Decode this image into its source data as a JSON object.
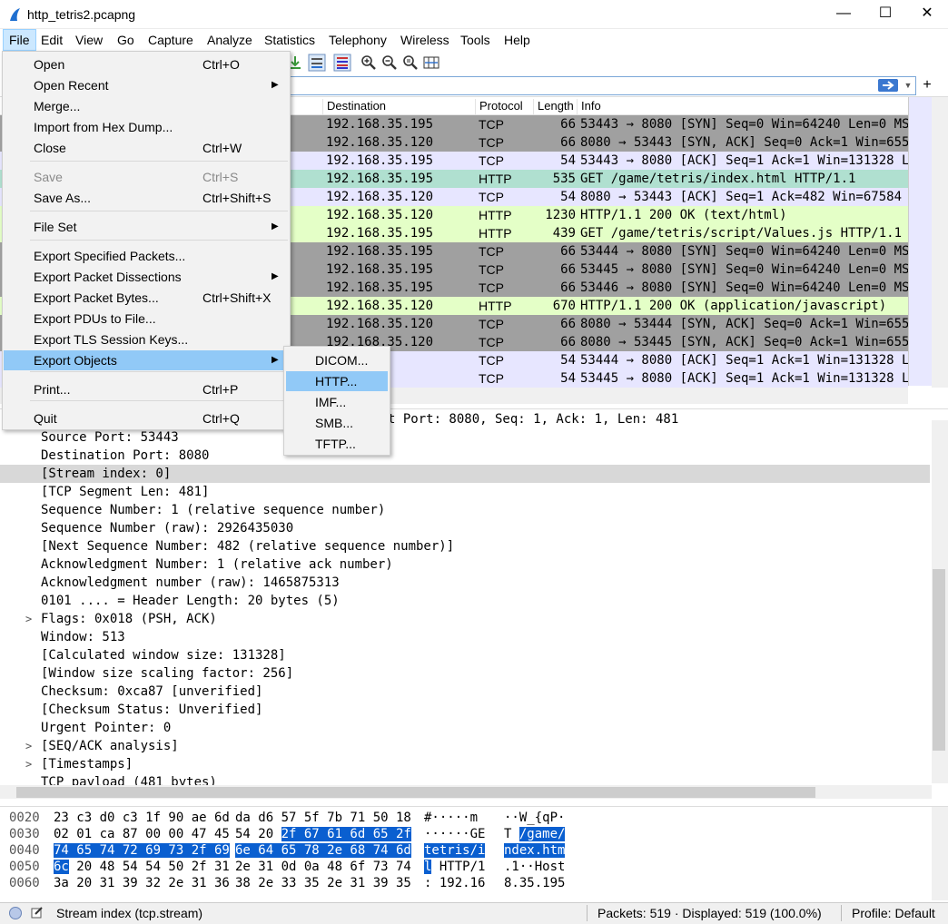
{
  "window": {
    "title": "http_tetris2.pcapng",
    "minimize": "—",
    "maximize": "☐",
    "close": "✕"
  },
  "menubar": [
    "File",
    "Edit",
    "View",
    "Go",
    "Capture",
    "Analyze",
    "Statistics",
    "Telephony",
    "Wireless",
    "Tools",
    "Help"
  ],
  "columns": {
    "destination": "Destination",
    "protocol": "Protocol",
    "length": "Length",
    "info": "Info"
  },
  "packets": [
    {
      "dst": "192.168.35.195",
      "proto": "TCP",
      "len": "66",
      "info": "53443 → 8080 [SYN] Seq=0 Win=64240 Len=0 MSS=",
      "style": "gray"
    },
    {
      "dst": "192.168.35.120",
      "proto": "TCP",
      "len": "66",
      "info": "8080 → 53443 [SYN, ACK] Seq=0 Ack=1 Win=65535",
      "style": "gray"
    },
    {
      "dst": "192.168.35.195",
      "proto": "TCP",
      "len": "54",
      "info": "53443 → 8080 [ACK] Seq=1 Ack=1 Win=131328 Len",
      "style": "lav"
    },
    {
      "dst": "192.168.35.195",
      "proto": "HTTP",
      "len": "535",
      "info": "GET /game/tetris/index.html HTTP/1.1",
      "style": "sel"
    },
    {
      "dst": "192.168.35.120",
      "proto": "TCP",
      "len": "54",
      "info": "8080 → 53443 [ACK] Seq=1 Ack=482 Win=67584 Le",
      "style": "lav"
    },
    {
      "dst": "192.168.35.120",
      "proto": "HTTP",
      "len": "1230",
      "info": "HTTP/1.1 200 OK  (text/html)",
      "style": "green"
    },
    {
      "dst": "192.168.35.195",
      "proto": "HTTP",
      "len": "439",
      "info": "GET /game/tetris/script/Values.js HTTP/1.1",
      "style": "green"
    },
    {
      "dst": "192.168.35.195",
      "proto": "TCP",
      "len": "66",
      "info": "53444 → 8080 [SYN] Seq=0 Win=64240 Len=0 MSS=",
      "style": "gray"
    },
    {
      "dst": "192.168.35.195",
      "proto": "TCP",
      "len": "66",
      "info": "53445 → 8080 [SYN] Seq=0 Win=64240 Len=0 MSS=",
      "style": "gray"
    },
    {
      "dst": "192.168.35.195",
      "proto": "TCP",
      "len": "66",
      "info": "53446 → 8080 [SYN] Seq=0 Win=64240 Len=0 MSS=",
      "style": "gray"
    },
    {
      "dst": "192.168.35.120",
      "proto": "HTTP",
      "len": "670",
      "info": "HTTP/1.1 200 OK  (application/javascript)",
      "style": "green"
    },
    {
      "dst": "192.168.35.120",
      "proto": "TCP",
      "len": "66",
      "info": "8080 → 53444 [SYN, ACK] Seq=0 Ack=1 Win=65535",
      "style": "gray"
    },
    {
      "dst": "192.168.35.120",
      "proto": "TCP",
      "len": "66",
      "info": "8080 → 53445 [SYN, ACK] Seq=0 Ack=1 Win=65535",
      "style": "gray"
    },
    {
      "dst": ".35.195",
      "proto": "TCP",
      "len": "54",
      "info": "53444 → 8080 [ACK] Seq=1 Ack=1 Win=131328 Len",
      "style": "lav"
    },
    {
      "dst": ".35.195",
      "proto": "TCP",
      "len": "54",
      "info": "53445 → 8080 [ACK] Seq=1 Ack=1 Win=131328 Len",
      "style": "lav"
    }
  ],
  "detail": [
    {
      "text": "t Port: 8080, Seq: 1, Ack: 1, Len: 481",
      "exp": ""
    },
    {
      "text": "Source Port: 53443",
      "exp": ""
    },
    {
      "text": "Destination Port: 8080",
      "exp": ""
    },
    {
      "text": "[Stream index: 0]",
      "exp": "",
      "hl": true
    },
    {
      "text": "[TCP Segment Len: 481]",
      "exp": ""
    },
    {
      "text": "Sequence Number: 1    (relative sequence number)",
      "exp": ""
    },
    {
      "text": "Sequence Number (raw): 2926435030",
      "exp": ""
    },
    {
      "text": "[Next Sequence Number: 482    (relative sequence number)]",
      "exp": ""
    },
    {
      "text": "Acknowledgment Number: 1    (relative ack number)",
      "exp": ""
    },
    {
      "text": "Acknowledgment number (raw): 1465875313",
      "exp": ""
    },
    {
      "text": "0101 .... = Header Length: 20 bytes (5)",
      "exp": ""
    },
    {
      "text": "Flags: 0x018 (PSH, ACK)",
      "exp": ">"
    },
    {
      "text": "Window: 513",
      "exp": ""
    },
    {
      "text": "[Calculated window size: 131328]",
      "exp": ""
    },
    {
      "text": "[Window size scaling factor: 256]",
      "exp": ""
    },
    {
      "text": "Checksum: 0xca87 [unverified]",
      "exp": ""
    },
    {
      "text": "[Checksum Status: Unverified]",
      "exp": ""
    },
    {
      "text": "Urgent Pointer: 0",
      "exp": ""
    },
    {
      "text": "[SEQ/ACK analysis]",
      "exp": ">"
    },
    {
      "text": "[Timestamps]",
      "exp": ">"
    },
    {
      "text": "TCP payload (481 bytes)",
      "exp": ""
    }
  ],
  "hex": [
    {
      "off": "0020",
      "b1": "23 c3 d0 c3 1f 90 ae 6d",
      "b2": "da d6 57 5f 7b 71 50 18",
      "a1": "#·····m ",
      "a2": "··W_{qP·",
      "sel1": "",
      "sel2": "",
      "asel1": "",
      "asel2": ""
    },
    {
      "off": "0030",
      "b1": "02 01 ca 87 00 00 47 45",
      "b2": "54 20 ",
      "b2sel": "2f 67 61 6d 65 2f",
      "a1": "······GE",
      "a2": "T ",
      "a2sel": "/game/"
    },
    {
      "off": "0040",
      "b1sel": "74 65 74 72 69 73 2f 69",
      "b2sel": "6e 64 65 78 2e 68 74 6d",
      "a1sel": "tetris/i",
      "a2sel": "ndex.htm"
    },
    {
      "off": "0050",
      "b1selpre": "6c",
      "b1": " 20 48 54 54 50 2f 31",
      "b2": "2e 31 0d 0a 48 6f 73 74",
      "a1selpre": "l",
      "a1": " HTTP/1",
      "a2": ".1··Host"
    },
    {
      "off": "0060",
      "b1": "3a 20 31 39 32 2e 31 36",
      "b2": "38 2e 33 35 2e 31 39 35",
      "a1": ": 192.16",
      "a2": "8.35.195"
    }
  ],
  "status": {
    "field": "Stream index (tcp.stream)",
    "packets": "Packets: 519 · Displayed: 519 (100.0%)",
    "profile": "Profile: Default"
  },
  "file_menu": [
    {
      "label": "Open",
      "shortcut": "Ctrl+O"
    },
    {
      "label": "Open Recent",
      "submenu": true
    },
    {
      "label": "Merge..."
    },
    {
      "label": "Import from Hex Dump..."
    },
    {
      "label": "Close",
      "shortcut": "Ctrl+W"
    },
    {
      "label": "Save",
      "shortcut": "Ctrl+S",
      "disabled": true
    },
    {
      "label": "Save As...",
      "shortcut": "Ctrl+Shift+S"
    },
    {
      "label": "File Set",
      "submenu": true
    },
    {
      "label": "Export Specified Packets..."
    },
    {
      "label": "Export Packet Dissections",
      "submenu": true
    },
    {
      "label": "Export Packet Bytes...",
      "shortcut": "Ctrl+Shift+X"
    },
    {
      "label": "Export PDUs to File..."
    },
    {
      "label": "Export TLS Session Keys..."
    },
    {
      "label": "Export Objects",
      "submenu": true,
      "hover": true
    },
    {
      "label": "Print...",
      "shortcut": "Ctrl+P"
    },
    {
      "label": "Quit",
      "shortcut": "Ctrl+Q"
    }
  ],
  "export_objects_menu": [
    {
      "label": "DICOM..."
    },
    {
      "label": "HTTP...",
      "hover": true
    },
    {
      "label": "IMF..."
    },
    {
      "label": "SMB..."
    },
    {
      "label": "TFTP..."
    }
  ],
  "icons": {
    "app": "wireshark-fin-icon",
    "filter_apply": "arrow-right-icon",
    "add_filter": "plus-icon"
  },
  "colors": {
    "accent": "#0a5fd0",
    "menu_hover": "#91c9f7",
    "row_gray": "#a0a0a0",
    "row_lavender": "#e7e6ff",
    "row_green": "#e4ffc7",
    "row_selected": "#b0e0d0"
  }
}
